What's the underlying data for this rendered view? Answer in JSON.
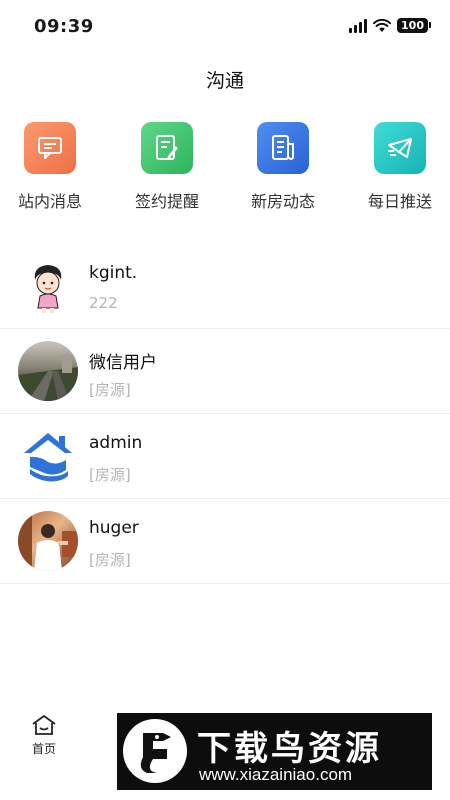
{
  "status_bar": {
    "time": "09:39",
    "battery": "100"
  },
  "header": {
    "title": "沟通"
  },
  "shortcuts": [
    {
      "label": "站内消息",
      "icon": "message-icon",
      "color": "#f37f50"
    },
    {
      "label": "签约提醒",
      "icon": "sign-reminder-icon",
      "color": "#3ec46b"
    },
    {
      "label": "新房动态",
      "icon": "document-icon",
      "color": "#2f6fe0"
    },
    {
      "label": "每日推送",
      "icon": "mail-icon",
      "color": "#1fc2bf"
    }
  ],
  "conversations": [
    {
      "name": "kgint.",
      "preview": "222",
      "avatar": "cartoon-avatar"
    },
    {
      "name": "微信用户",
      "preview": "[房源]",
      "avatar": "street-photo-avatar"
    },
    {
      "name": "admin",
      "preview": "[房源]",
      "avatar": "house-logo-avatar"
    },
    {
      "name": "huger",
      "preview": "[房源]",
      "avatar": "person-photo-avatar"
    }
  ],
  "tab_bar": {
    "home_label": "首页"
  },
  "watermark": {
    "title": "下载鸟资源",
    "url": "www.xiazainiao.com"
  }
}
